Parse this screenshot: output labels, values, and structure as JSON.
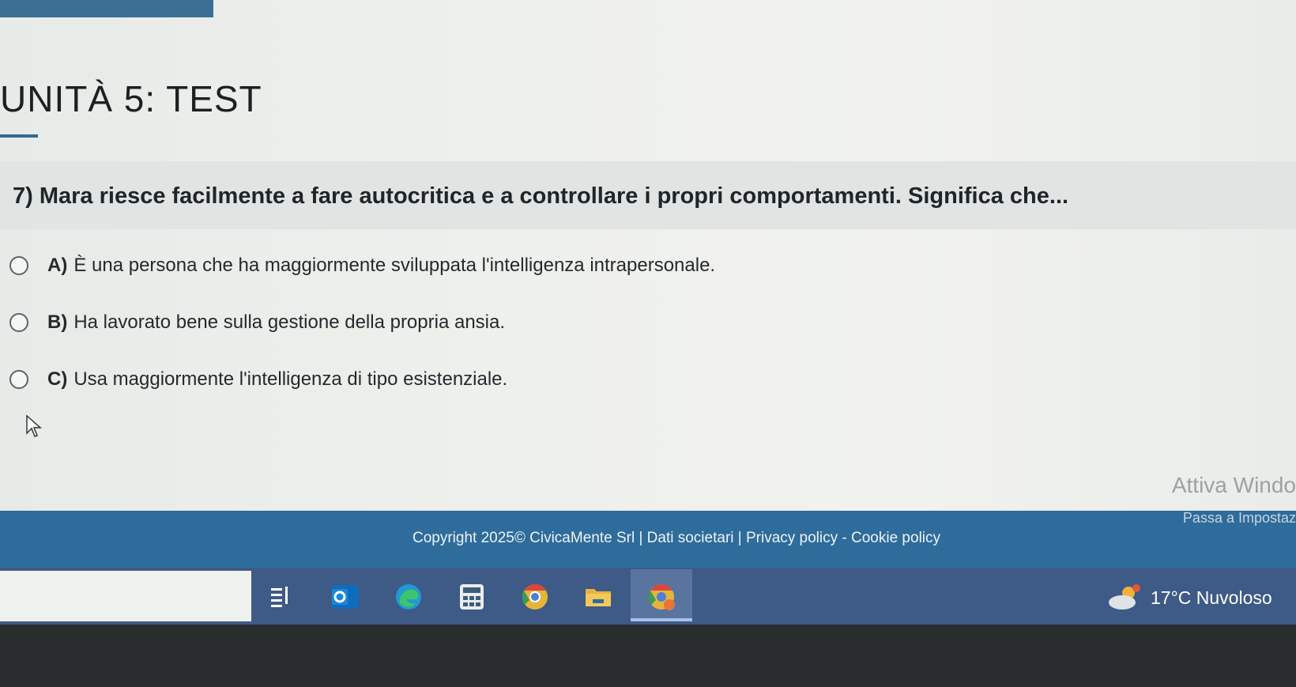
{
  "page": {
    "title": "UNITÀ 5: TEST"
  },
  "question": {
    "text": "7) Mara riesce facilmente a fare autocritica e a controllare i propri comportamenti. Significa che..."
  },
  "answers": [
    {
      "letter": "A)",
      "text": "È una persona che ha maggiormente sviluppata l'intelligenza intrapersonale."
    },
    {
      "letter": "B)",
      "text": "Ha lavorato bene sulla gestione della propria ansia."
    },
    {
      "letter": "C)",
      "text": "Usa maggiormente l'intelligenza di tipo esistenziale."
    }
  ],
  "watermark": {
    "title": "Attiva Windo",
    "subtitle": "Passa a Impostaz"
  },
  "footer": {
    "text": "Copyright 2025© CivicaMente Srl | Dati societari | Privacy policy - Cookie policy"
  },
  "taskbar": {
    "icons": [
      "task-view-icon",
      "outlook-icon",
      "edge-icon",
      "calculator-icon",
      "chrome-icon",
      "file-explorer-icon",
      "chrome-profile-icon"
    ],
    "weather": {
      "temperature": "17°C",
      "condition": "Nuvoloso"
    }
  },
  "colors": {
    "accent": "#2e6c9b",
    "taskbar": "#3e5a86"
  }
}
